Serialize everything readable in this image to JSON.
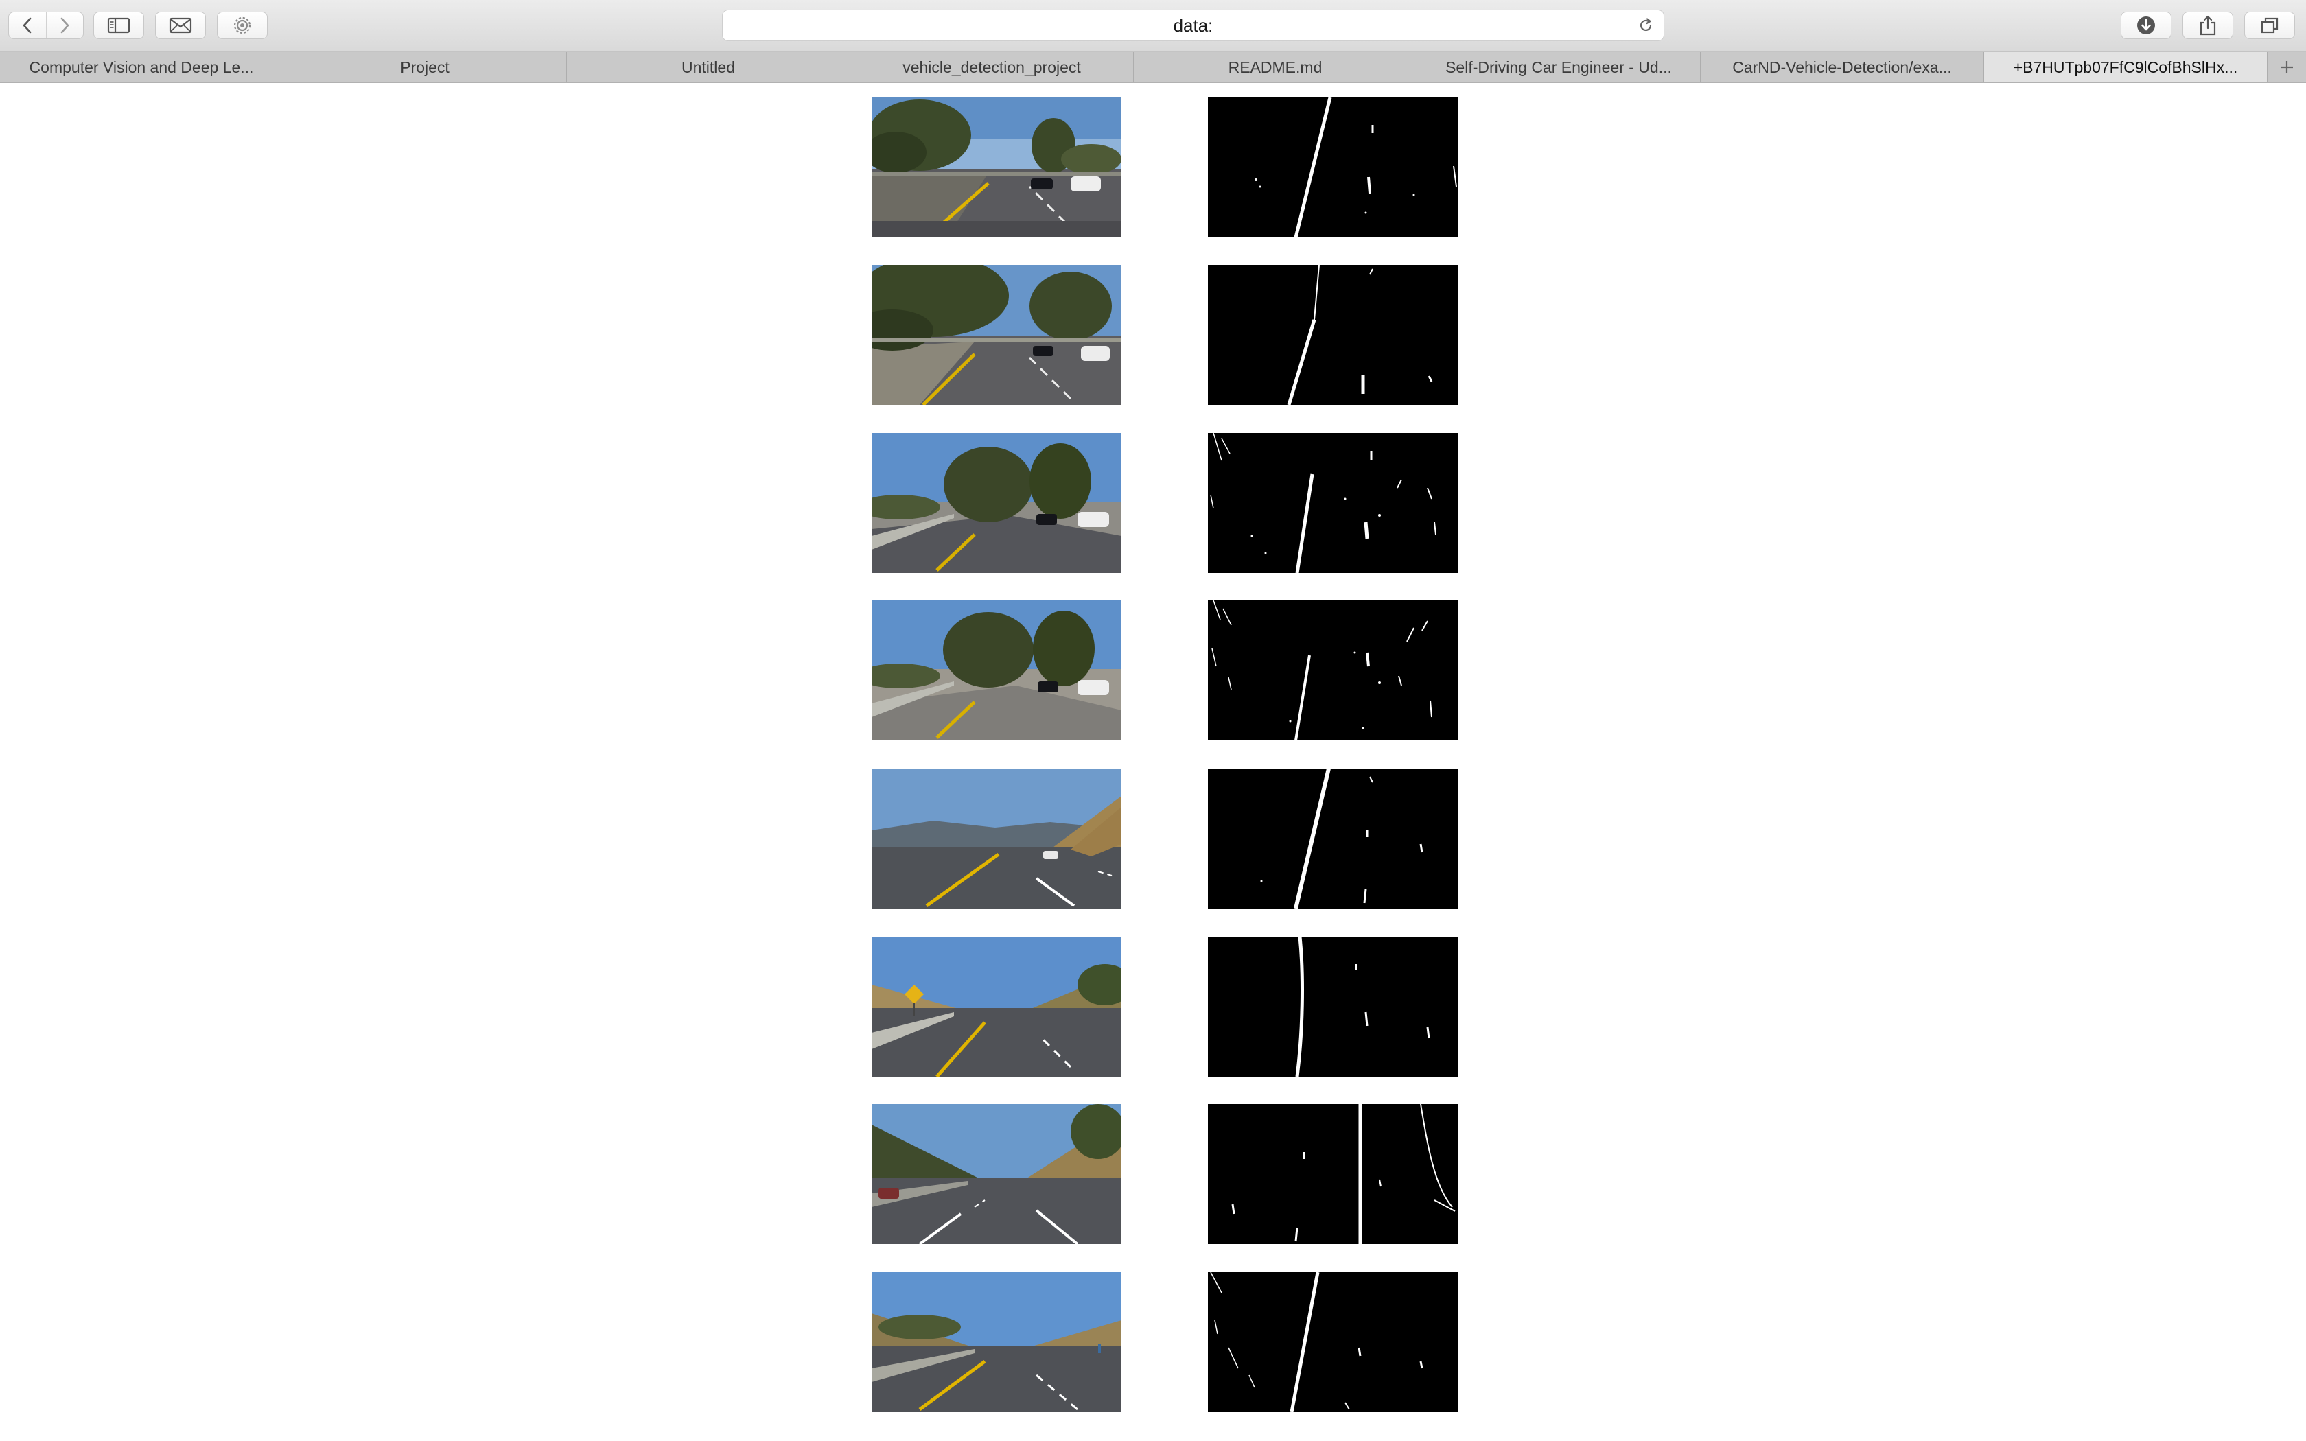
{
  "browser": {
    "address_bar": "data:",
    "tabs": [
      {
        "label": "Computer Vision and Deep Le...",
        "active": false
      },
      {
        "label": "Project",
        "active": false
      },
      {
        "label": "Untitled",
        "active": false
      },
      {
        "label": "vehicle_detection_project",
        "active": false
      },
      {
        "label": "README.md",
        "active": false
      },
      {
        "label": "Self-Driving Car Engineer - Ud...",
        "active": false
      },
      {
        "label": "CarND-Vehicle-Detection/exa...",
        "active": false
      },
      {
        "label": "+B7HUTpb07FfC9lCofBhSlHx...",
        "active": true
      }
    ]
  },
  "icons": {
    "back": "chevron-left-icon",
    "forward": "chevron-right-icon",
    "sidebar": "sidebar-icon",
    "mail": "mail-icon",
    "settings": "gear-icon",
    "reload": "reload-icon",
    "downloads": "download-icon",
    "share": "share-icon",
    "tabs_overview": "tabs-overview-icon",
    "new_tab": "plus-icon"
  },
  "image_pairs": [
    {
      "original": "road-image-1",
      "binary": "lane-binary-1"
    },
    {
      "original": "road-image-2",
      "binary": "lane-binary-2"
    },
    {
      "original": "road-image-3",
      "binary": "lane-binary-3"
    },
    {
      "original": "road-image-4",
      "binary": "lane-binary-4"
    },
    {
      "original": "road-image-5",
      "binary": "lane-binary-5"
    },
    {
      "original": "road-image-6",
      "binary": "lane-binary-6"
    },
    {
      "original": "road-image-7",
      "binary": "lane-binary-7"
    },
    {
      "original": "road-image-8",
      "binary": "lane-binary-8"
    }
  ]
}
